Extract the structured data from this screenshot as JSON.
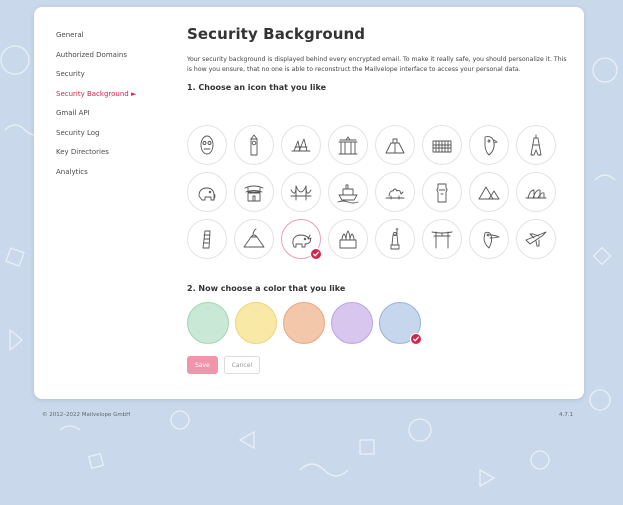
{
  "sidebar": {
    "items": [
      {
        "label": "General",
        "active": false
      },
      {
        "label": "Authorized Domains",
        "active": false
      },
      {
        "label": "Security",
        "active": false
      },
      {
        "label": "Security Background ►",
        "active": true
      },
      {
        "label": "Gmail API",
        "active": false
      },
      {
        "label": "Security Log",
        "active": false
      },
      {
        "label": "Key Directories",
        "active": false
      },
      {
        "label": "Analytics",
        "active": false
      }
    ]
  },
  "main": {
    "title": "Security Background",
    "description": "Your security background is displayed behind every encrypted email. To make it really safe, you should personalize it. This is how you ensure, that no one is able to reconstruct the Mailvelope interface to access your personal data.",
    "icon_heading": "1. Choose an icon that you like",
    "color_heading": "2. Now choose a color that you like",
    "icons": [
      "tribal-mask-icon",
      "big-ben-icon",
      "opera-house-icon",
      "brandenburg-gate-icon",
      "pyramid-of-kukulcan-icon",
      "colosseum-icon",
      "parrot-icon",
      "eiffel-tower-icon",
      "elephant-icon",
      "chinese-temple-icon",
      "golden-gate-bridge-icon",
      "ship-icon",
      "camel-icon",
      "moai-icon",
      "pyramids-icon",
      "sydney-opera-house-icon",
      "leaning-tower-icon",
      "volcano-icon",
      "rhino-icon",
      "st-basil-cathedral-icon",
      "statue-of-liberty-icon",
      "torii-gate-icon",
      "toucan-icon",
      "airplane-icon"
    ],
    "selected_icon_index": 18,
    "colors": [
      "#c9e9d6",
      "#f8e9a6",
      "#f3c7a9",
      "#d8c6ee",
      "#c6d6ec"
    ],
    "color_borders": [
      "#9fd6b4",
      "#eed579",
      "#e9a783",
      "#bda3e2",
      "#99b3d8"
    ],
    "selected_color_index": 4,
    "save_label": "Save",
    "cancel_label": "Cancel"
  },
  "footer": {
    "copyright": "© 2012–2022  Mailvelope GmbH",
    "version": "4.7.1"
  },
  "theme": {
    "accent": "#d4254c",
    "background": "#c9d8ea"
  }
}
